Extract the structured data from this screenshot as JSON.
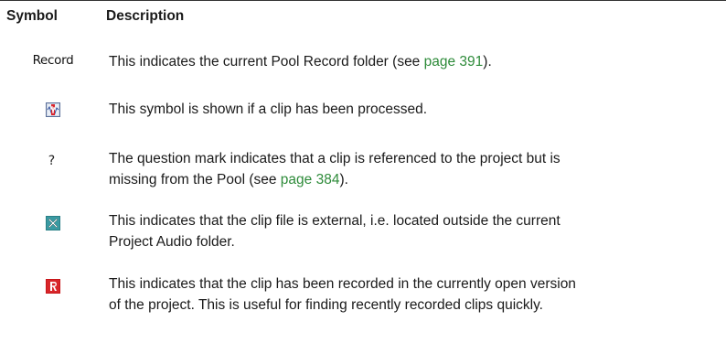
{
  "header": {
    "symbol": "Symbol",
    "description": "Description"
  },
  "rows": [
    {
      "symbol_text": "Record",
      "icon": "record-folder-text",
      "text_before": "This indicates the current Pool Record folder (see ",
      "link": "page 391",
      "text_after": ")."
    },
    {
      "icon": "processed-clip-icon",
      "text": "This symbol is shown if a clip has been processed."
    },
    {
      "symbol_text": "?",
      "icon": "question-mark",
      "line1": "The question mark indicates that a clip is referenced to the project but is",
      "line2_before": "missing from the Pool (see ",
      "link": "page 384",
      "line2_after": ")."
    },
    {
      "icon": "external-file-icon",
      "line1": "This indicates that the clip file is external, i.e. located outside the current",
      "line2": "Project Audio folder."
    },
    {
      "icon": "recorded-in-version-icon",
      "line1": "This indicates that the clip has been recorded in the currently open version",
      "line2": "of the project. This is useful for finding recently recorded clips quickly."
    }
  ],
  "colors": {
    "link": "#2e8b3a",
    "external_icon": "#2a7f86",
    "recorded_icon": "#c8171b"
  }
}
